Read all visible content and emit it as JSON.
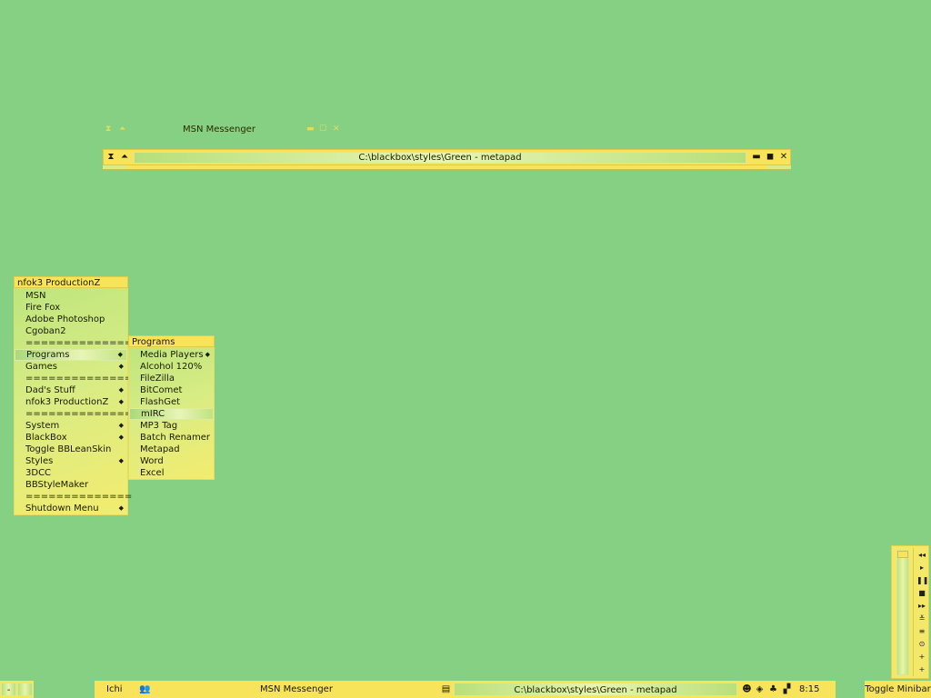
{
  "msn_window": {
    "title": "MSN Messenger",
    "left_icons": [
      "hourglass-icon",
      "shade-icon"
    ],
    "right_icons": [
      "minimize-icon",
      "maximize-icon",
      "close-icon"
    ]
  },
  "metapad_window": {
    "title": "C:\\blackbox\\styles\\Green - metapad"
  },
  "root_menu": {
    "title": "nfok3 ProductionZ",
    "items": [
      {
        "label": "MSN"
      },
      {
        "label": "Fire Fox"
      },
      {
        "label": "Adobe Photoshop"
      },
      {
        "label": "Cgoban2"
      },
      {
        "label": "==============",
        "separator": true
      },
      {
        "label": "Programs",
        "submenu": true,
        "active": true
      },
      {
        "label": "Games",
        "submenu": true
      },
      {
        "label": "==============",
        "separator": true
      },
      {
        "label": "Dad's Stuff",
        "submenu": true
      },
      {
        "label": "nfok3 ProductionZ",
        "submenu": true
      },
      {
        "label": "==============",
        "separator": true
      },
      {
        "label": "System",
        "submenu": true
      },
      {
        "label": "BlackBox",
        "submenu": true
      },
      {
        "label": "Toggle BBLeanSkin"
      },
      {
        "label": "Styles",
        "submenu": true
      },
      {
        "label": "3DCC"
      },
      {
        "label": "BBStyleMaker"
      },
      {
        "label": "==============",
        "separator": true
      },
      {
        "label": "Shutdown Menu",
        "submenu": true
      }
    ]
  },
  "programs_menu": {
    "title": "Programs",
    "items": [
      {
        "label": "Media Players",
        "submenu": true
      },
      {
        "label": "Alcohol 120%"
      },
      {
        "label": "FileZilla"
      },
      {
        "label": "BitComet"
      },
      {
        "label": "FlashGet"
      },
      {
        "label": "mIRC",
        "hover": true
      },
      {
        "label": "MP3 Tag"
      },
      {
        "label": "Batch Renamer"
      },
      {
        "label": "Metapad"
      },
      {
        "label": "Word"
      },
      {
        "label": "Excel"
      }
    ]
  },
  "taskbar": {
    "left_button": "-",
    "workspace": "Ichi",
    "tasks": [
      "MSN Messenger",
      "C:\\blackbox\\styles\\Green - metapad"
    ],
    "clock": "8:15 PM",
    "toggle_label": "Toggle Minibar",
    "tray_icons": [
      "alien-icon",
      "network-icon",
      "msn-icon",
      "flag-icon"
    ]
  },
  "mediabar": {
    "buttons": [
      "rewind-icon",
      "play-icon",
      "pause-icon",
      "stop-icon",
      "forward-icon",
      "eject-icon",
      "playlist-icon",
      "repeat-icon",
      "volume-up-icon",
      "volume-down-icon"
    ],
    "glyphs": [
      "◂◂",
      "▸",
      "❚❚",
      "■",
      "▸▸",
      "≚",
      "≡",
      "⊙",
      "+",
      "+"
    ]
  },
  "colors": {
    "desktop": "#86d083",
    "accent_yellow": "#f8e45a",
    "menu_green": "#bfe57d"
  }
}
